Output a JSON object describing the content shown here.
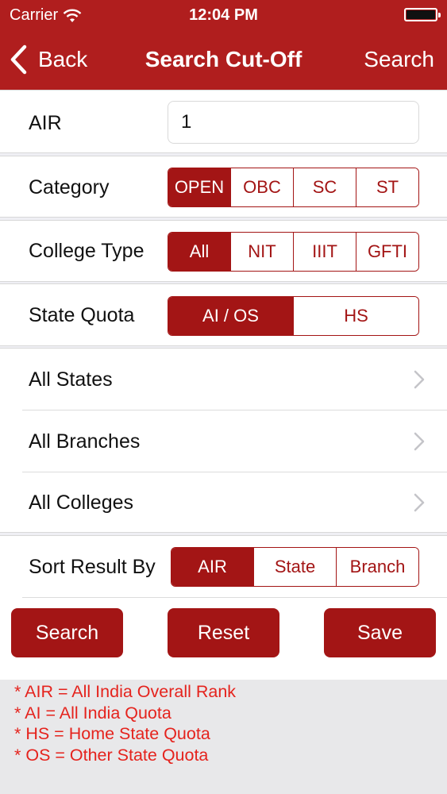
{
  "status_bar": {
    "carrier": "Carrier",
    "time": "12:04 PM",
    "icons": [
      "wifi-icon",
      "battery-icon"
    ]
  },
  "nav": {
    "back_label": "Back",
    "title": "Search Cut-Off",
    "search_label": "Search"
  },
  "form": {
    "air": {
      "label": "AIR",
      "value": "1"
    },
    "category": {
      "label": "Category",
      "options": [
        "OPEN",
        "OBC",
        "SC",
        "ST"
      ],
      "selected": "OPEN"
    },
    "college_type": {
      "label": "College Type",
      "options": [
        "All",
        "NIT",
        "IIIT",
        "GFTI"
      ],
      "selected": "All"
    },
    "state_quota": {
      "label": "State Quota",
      "options": [
        "AI / OS",
        "HS"
      ],
      "selected": "AI / OS"
    },
    "filters": [
      {
        "label": "All States",
        "icon": "chevron-right-icon"
      },
      {
        "label": "All Branches",
        "icon": "chevron-right-icon"
      },
      {
        "label": "All Colleges",
        "icon": "chevron-right-icon"
      }
    ],
    "sort": {
      "label": "Sort Result By",
      "options": [
        "AIR",
        "State",
        "Branch"
      ],
      "selected": "AIR"
    }
  },
  "actions": {
    "search_label": "Search",
    "reset_label": "Reset",
    "save_label": "Save"
  },
  "notes": [
    "* AIR = All India Overall Rank",
    "* AI = All India Quota",
    "* HS = Home State Quota",
    "* OS = Other State Quota"
  ],
  "colors": {
    "primary": "#a31515",
    "header": "#b01e1e",
    "note_text": "#e5231d",
    "background": "#efeff4"
  }
}
